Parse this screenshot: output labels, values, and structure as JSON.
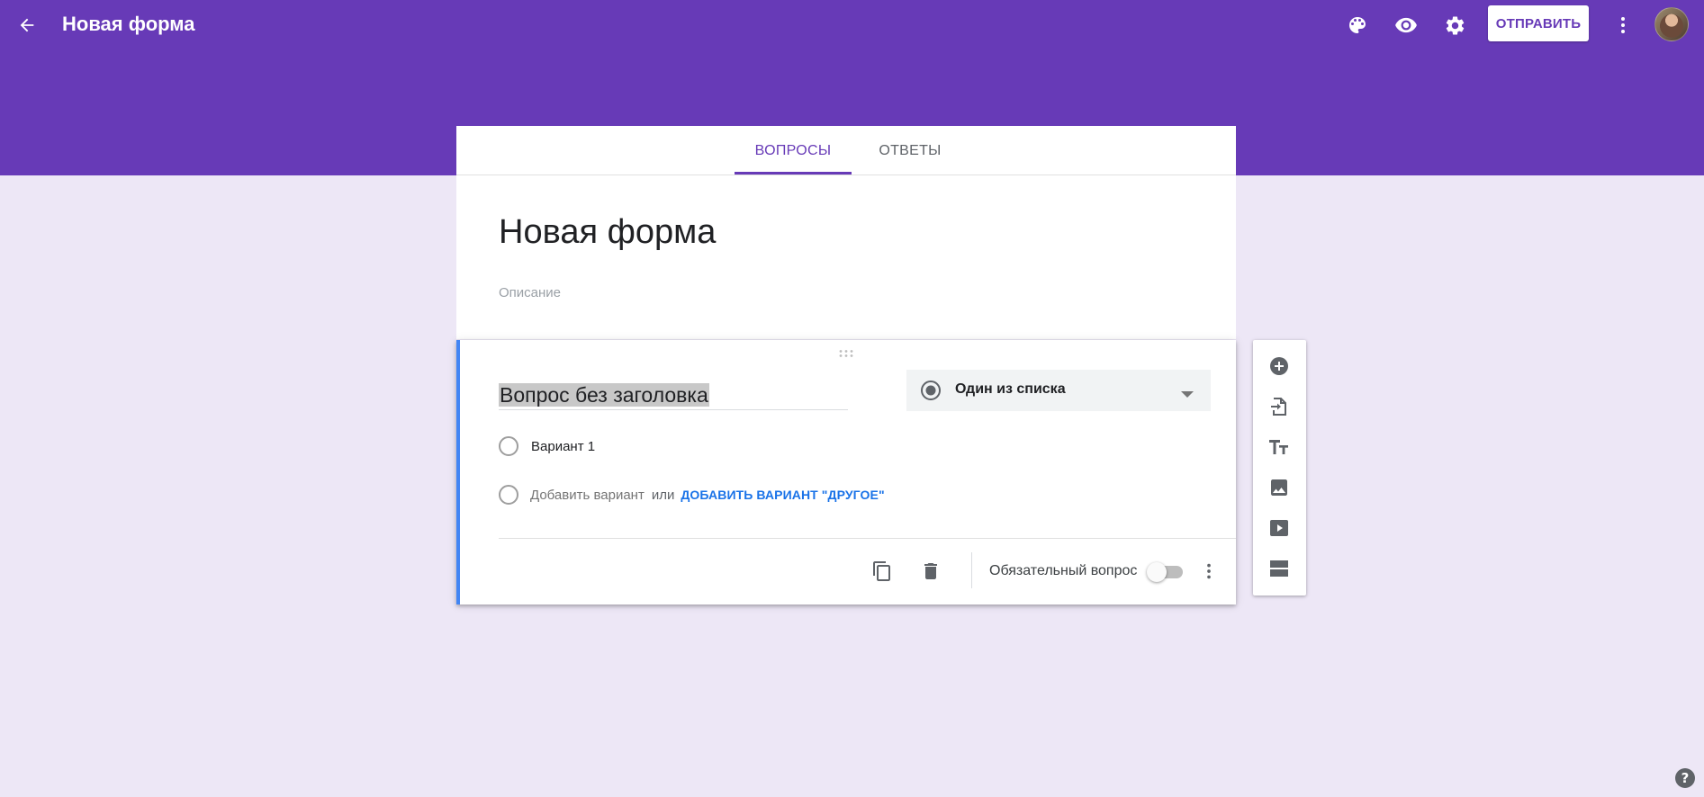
{
  "header": {
    "title": "Новая форма",
    "send_label": "ОТПРАВИТЬ",
    "icons": [
      "back-arrow-icon",
      "palette-icon",
      "eye-icon",
      "gear-icon",
      "more-vert-icon"
    ]
  },
  "tabs": [
    {
      "label": "ВОПРОСЫ",
      "active": true
    },
    {
      "label": "ОТВЕТЫ",
      "active": false
    }
  ],
  "form": {
    "title": "Новая форма",
    "description_placeholder": "Описание"
  },
  "question": {
    "title": "Вопрос без заголовка",
    "type_label": "Один из списка",
    "options": [
      {
        "label": "Вариант 1"
      }
    ],
    "add_option": "Добавить вариант",
    "or": "или",
    "add_other": "ДОБАВИТЬ ВАРИАНТ \"ДРУГОЕ\"",
    "required_label": "Обязательный вопрос",
    "required": false
  },
  "side_toolbar": [
    "add-question-icon",
    "import-questions-icon",
    "title-text-icon",
    "image-icon",
    "video-icon",
    "section-icon"
  ],
  "colors": {
    "theme": "#673ab7",
    "background": "#ede7f6",
    "accent_blue": "#4285f4",
    "link": "#1a73e8"
  }
}
